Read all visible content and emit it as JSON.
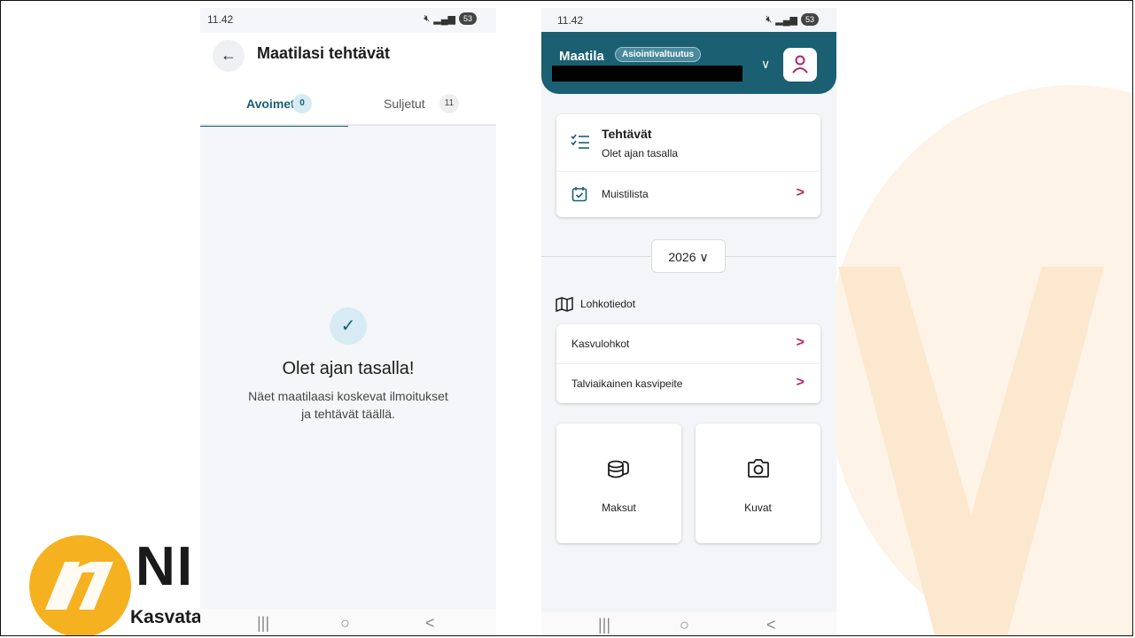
{
  "brand": {
    "logo_letters": "NI",
    "logo_tagline": "Kasvatar",
    "accent_color": "#f5b120",
    "primary_color": "#1b5f73",
    "chevron_color": "#b0256a"
  },
  "phone_left": {
    "status": {
      "time": "11.42",
      "battery": "53",
      "signal": "4G"
    },
    "title": "Maatilasi tehtävät",
    "tabs": [
      {
        "label": "Avoimet",
        "count": "0",
        "active": true
      },
      {
        "label": "Suljetut",
        "count": "11",
        "active": false
      }
    ],
    "empty_state": {
      "title": "Olet ajan tasalla!",
      "line1": "Näet maatilaasi koskevat ilmoitukset",
      "line2": "ja tehtävät täällä."
    },
    "nav": {
      "recent": "|||",
      "home": "○",
      "back": "<"
    }
  },
  "phone_right": {
    "status": {
      "time": "11.42",
      "battery": "53"
    },
    "header": {
      "farm_label": "Maatila",
      "badge": "Asiointivaltuutus"
    },
    "tasks_card": {
      "title": "Tehtävät",
      "subtitle": "Olet ajan tasalla",
      "checklist_label": "Muistilista"
    },
    "year": "2026",
    "plots_section": {
      "title": "Lohkotiedot",
      "items": [
        {
          "label": "Kasvulohkot"
        },
        {
          "label": "Talviaikainen kasvipeite"
        }
      ]
    },
    "tiles": [
      {
        "label": "Maksut",
        "icon": "coins-icon"
      },
      {
        "label": "Kuvat",
        "icon": "camera-icon"
      }
    ],
    "nav": {
      "recent": "|||",
      "home": "○",
      "back": "<"
    }
  }
}
